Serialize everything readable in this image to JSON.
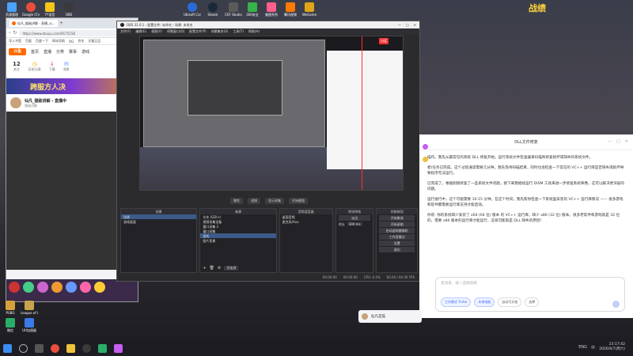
{
  "desktop": {
    "top_icons": [
      {
        "label": "资源管理",
        "color": "#4aa3ff"
      },
      {
        "label": "Google Chrome",
        "color": "#e94e3c"
      },
      {
        "label": "YY语音",
        "color": "#f5c518"
      },
      {
        "label": "OBS",
        "color": "#3a3a3a"
      },
      {
        "label": "Ubisoft Conn...",
        "color": "#2a6bd8"
      },
      {
        "label": "Steam",
        "color": "#1b2838"
      },
      {
        "label": "CEF Studio",
        "color": "#5b5b5b"
      },
      {
        "label": "360安全",
        "color": "#38b24a"
      },
      {
        "label": "美图秀秀",
        "color": "#ff5f8f"
      },
      {
        "label": "腾讯视频",
        "color": "#ff7a00"
      },
      {
        "label": "WeGame",
        "color": "#e0a419"
      }
    ],
    "corner_text": "战绩",
    "bottom_icons": [
      {
        "label": "PUBG",
        "color": "#d6a13a"
      },
      {
        "label": "League of Legends",
        "color": "#c9a24e"
      },
      {
        "label": "微信",
        "color": "#2aae67"
      },
      {
        "label": "UU加速器",
        "color": "#3a79e8"
      },
      {
        "label": "迅游加速器",
        "color": "#e23f3f"
      },
      {
        "label": "Riot Client",
        "color": "#d13639"
      }
    ]
  },
  "browser": {
    "tab_title": "仙凡_猫敌讲解 - 直播_斗...",
    "url": "https://www.douyu.com/9175158",
    "bookmarks": [
      "导入书签",
      "百度",
      "百度一下",
      "网站导航",
      "OG",
      "京东",
      "天猫正品"
    ],
    "site_logo": "斗鱼",
    "nav": [
      "首页",
      "直播",
      "分类",
      "赛事",
      "游戏"
    ],
    "stats": [
      {
        "value": "12",
        "label": "关注"
      },
      {
        "value": "",
        "label": "历史记录"
      },
      {
        "value": "",
        "label": "下载"
      },
      {
        "value": "",
        "label": "消息"
      }
    ],
    "banner_text": "跨服方人决",
    "streamer_name": "仙凡_猫敌讲解 - 直播中",
    "streamer_sub": "猫敌讲解"
  },
  "obs": {
    "title": "OBS 31.0.1 - 配置文件: 未命名 - 场景: 未命名",
    "menus": [
      "文件(F)",
      "编辑(E)",
      "视图(V)",
      "停靠窗口(D)",
      "配置文件(P)",
      "场景集合(S)",
      "工具(T)",
      "帮助(H)"
    ],
    "red_tag": "迅猛",
    "label_bar": [
      "属性",
      "滤镜",
      "显示采集",
      "开始截图"
    ],
    "scenes_header": "场景",
    "scenes": [
      "场景",
      "游戏画面"
    ],
    "sources_header": "来源",
    "sources": [
      "文本 (GDI+)",
      "视频采集设备",
      "窗口采集 2",
      "窗口采集",
      "游戏",
      "图片背景"
    ],
    "mixer_header": "音频混音器",
    "mixer": [
      "桌面音频",
      "麦克风/Aux"
    ],
    "transitions_header": "转场特效",
    "transition_value": "淡出",
    "duration_label": "时长",
    "duration_value": "300 ms",
    "controls_header": "控制按钮",
    "controls": [
      "开始推流",
      "开始录制",
      "启动虚拟摄像机",
      "工作室模式",
      "设置",
      "退出"
    ],
    "add_source": "添加源",
    "status": [
      "00:00:00",
      "00:00:00",
      "CPU: 0.4%",
      "60.00 / 60.00 FPS"
    ]
  },
  "chat": {
    "header": "DLL文件修复",
    "paragraphs": [
      "描作。我先从最常见的系统 DLL 修复开始。运行系统文件检查器来扫描和修复损坏或缺失的系统文件。",
      "者)任务已完成。这个过程通常需要几分钟。我先等待扫描结束，同时也会检查一下常见的 VC++ 运行库是否缺失或损坏导致程序无法运行。",
      "已完成了。根据刚刚修复了一些系统文件问题，接下来我继续运行 DISM 工具来进一步修复系统映像，这可以解决更深层的问题。",
      "运行进行中，这个可能需要 10-15 分钟。在这个时间，我先帮你检查一下系统里安装的 VC++ 运行库情况 —— 很多游戏和软件都需要运行库支持才能启动。",
      "你装: 你的系统缺少安装了 x64 (64 位) 版本 的 VC++ 运行库，缺少 x86 (32 位) 版本。很多老软件和游戏就是 32 位的，需要 x86 版本的运行库才能运行，这很可能就是 DLL 缺失的原因!"
    ],
    "input_placeholder": "发消息、按 / 选择技能",
    "pills": [
      "工作模式 Turbo",
      "本地电脑",
      "自动写文档",
      "选择"
    ],
    "user_label": "仙凡是猫"
  },
  "taskbar": {
    "clock_time": "23:17:42",
    "clock_date": "2026/6/7(周六)",
    "tray": [
      "ENG",
      "中"
    ]
  }
}
